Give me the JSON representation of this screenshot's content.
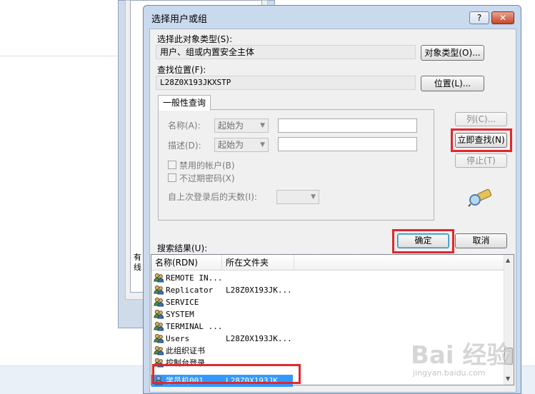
{
  "dialog": {
    "title": "选择用户或组",
    "help_label": "?",
    "close_label": "✕"
  },
  "object_type": {
    "label": "选择此对象类型(S):",
    "value": "用户、组或内置安全主体",
    "button": "对象类型(O)..."
  },
  "location": {
    "label": "查找位置(F):",
    "value": "L28Z0X193JKXSTP",
    "button": "位置(L)..."
  },
  "query": {
    "tab_label": "一般性查询",
    "name_label": "名称(A):",
    "name_mode": "起始为",
    "desc_label": "描述(D):",
    "desc_mode": "起始为",
    "disabled_accounts_label": "禁用的帐户(B)",
    "no_expire_label": "不过期密码(X)",
    "days_label": "自上次登录后的天数(I):"
  },
  "side_buttons": {
    "columns": "列(C)...",
    "find_now": "立即查找(N)",
    "stop": "停止(T)"
  },
  "actions": {
    "ok": "确定",
    "cancel": "取消"
  },
  "results": {
    "label": "搜索结果(U):",
    "columns": [
      "名称(RDN)",
      "所在文件夹"
    ],
    "rows": [
      {
        "name": "REMOTE IN...",
        "folder": ""
      },
      {
        "name": "Replicator",
        "folder": "L28Z0X193JK..."
      },
      {
        "name": "SERVICE",
        "folder": ""
      },
      {
        "name": "SYSTEM",
        "folder": ""
      },
      {
        "name": "TERMINAL ...",
        "folder": ""
      },
      {
        "name": "Users",
        "folder": "L28Z0X193JK..."
      },
      {
        "name": "此组织证书",
        "folder": ""
      },
      {
        "name": "控制台登录",
        "folder": ""
      },
      {
        "name": "学员机001",
        "folder": "L28Z0X193JK...",
        "selected": true
      }
    ]
  },
  "background": {
    "side_text": "有线"
  },
  "watermark": {
    "brand": "Bai 经验",
    "url": "jingyan.baidu.com"
  },
  "colors": {
    "highlight": "#e0282d",
    "selection": "#3399ff"
  }
}
